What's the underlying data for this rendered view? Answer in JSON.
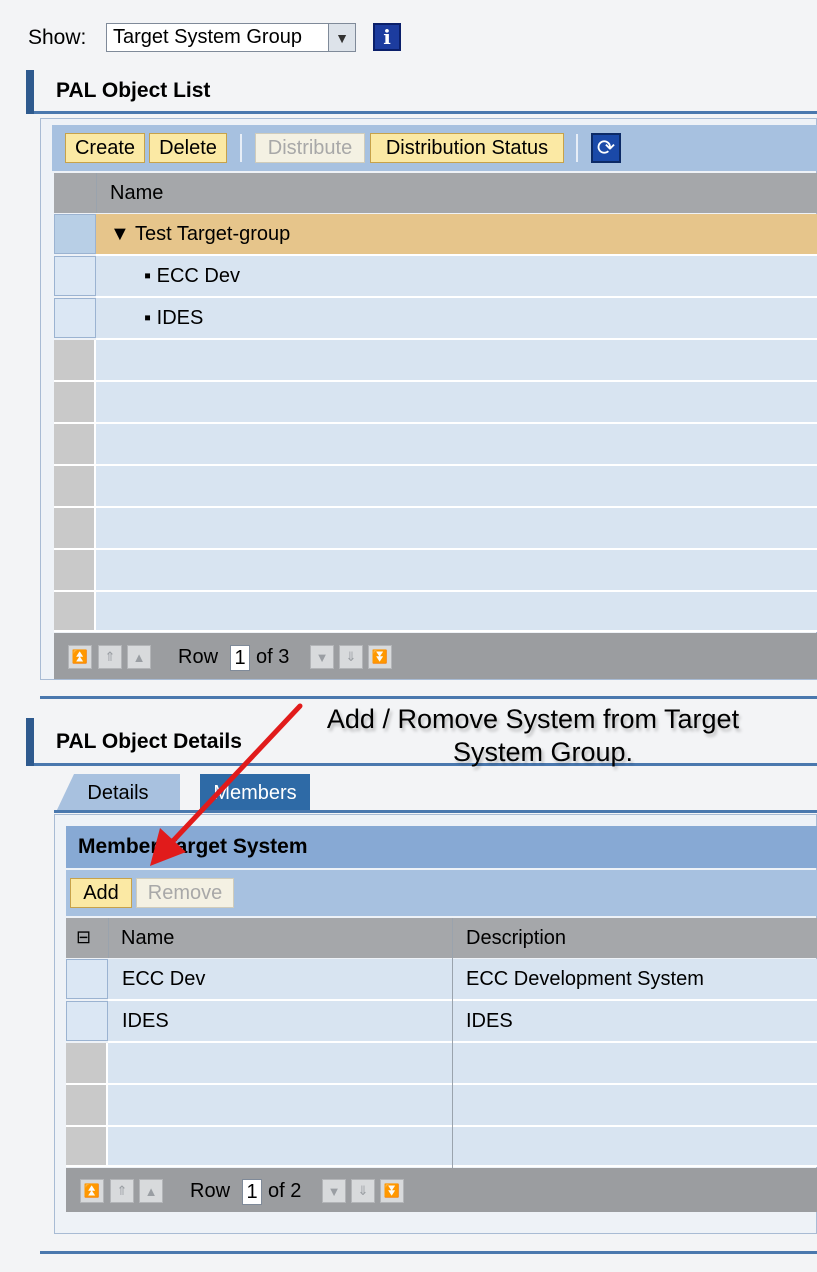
{
  "show": {
    "label": "Show:",
    "selected": "Target System Group",
    "info_icon": "i"
  },
  "object_list": {
    "title": "PAL Object List",
    "toolbar": {
      "create": "Create",
      "delete": "Delete",
      "distribute": "Distribute",
      "distribution_status": "Distribution Status",
      "refresh_icon": "refresh-icon"
    },
    "column_name": "Name",
    "rows": [
      {
        "label": "▼ Test Target-group"
      },
      {
        "label": "▪ ECC Dev"
      },
      {
        "label": "▪ IDES"
      }
    ],
    "pager": {
      "row_label": "Row",
      "current": "1",
      "of_label": "of 3"
    }
  },
  "details": {
    "title": "PAL Object Details",
    "annotation_line1": "Add / Romove System from Target",
    "annotation_line2": "System Group.",
    "tabs": {
      "details": "Details",
      "members": "Members"
    },
    "group_title": "Member Target System",
    "toolbar": {
      "add": "Add",
      "remove": "Remove"
    },
    "columns": {
      "name": "Name",
      "description": "Description"
    },
    "rows": [
      {
        "name": "ECC Dev",
        "description": "ECC Development System"
      },
      {
        "name": "IDES",
        "description": "IDES"
      }
    ],
    "pager": {
      "row_label": "Row",
      "current": "1",
      "of_label": "of 2"
    }
  },
  "colors": {
    "accent": "#2e5a8e",
    "button": "#fbe9a4",
    "selected_row": "#e6c58b",
    "arrow": "#e11b1b"
  }
}
